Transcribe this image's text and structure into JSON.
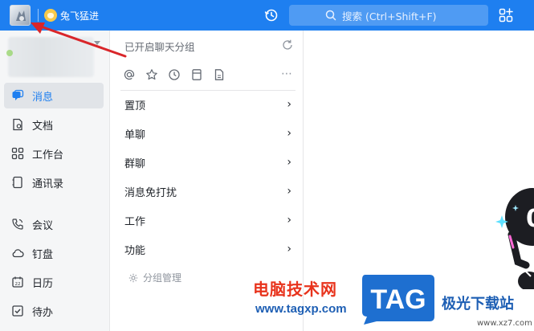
{
  "titlebar": {
    "org_name": "兔飞猛进",
    "search_placeholder": "搜索 (Ctrl+Shift+F)"
  },
  "leftnav": {
    "items": [
      {
        "label": "消息",
        "icon": "chat-bubble-icon",
        "active": true
      },
      {
        "label": "文档",
        "icon": "document-icon"
      },
      {
        "label": "工作台",
        "icon": "grid-apps-icon"
      },
      {
        "label": "通讯录",
        "icon": "contacts-icon"
      },
      {
        "label": "会议",
        "icon": "phone-call-icon"
      },
      {
        "label": "钉盘",
        "icon": "cloud-drive-icon"
      },
      {
        "label": "日历",
        "icon": "calendar-icon"
      },
      {
        "label": "待办",
        "icon": "checkbox-todo-icon"
      }
    ]
  },
  "group_panel": {
    "title": "已开启聊天分组",
    "groups": [
      {
        "label": "置顶"
      },
      {
        "label": "单聊"
      },
      {
        "label": "群聊"
      },
      {
        "label": "消息免打扰"
      },
      {
        "label": "工作"
      },
      {
        "label": "功能"
      }
    ],
    "manage_label": "分组管理"
  },
  "watermark": {
    "site_name_cn": "电脑技术网",
    "site_url": "www.tagxp.com",
    "logo_text": "TAG",
    "site2_name": "极光下载站",
    "site2_url": "www.xz7.com"
  },
  "colors": {
    "accent": "#1e7ff0",
    "annotation_arrow": "#d9262a"
  }
}
